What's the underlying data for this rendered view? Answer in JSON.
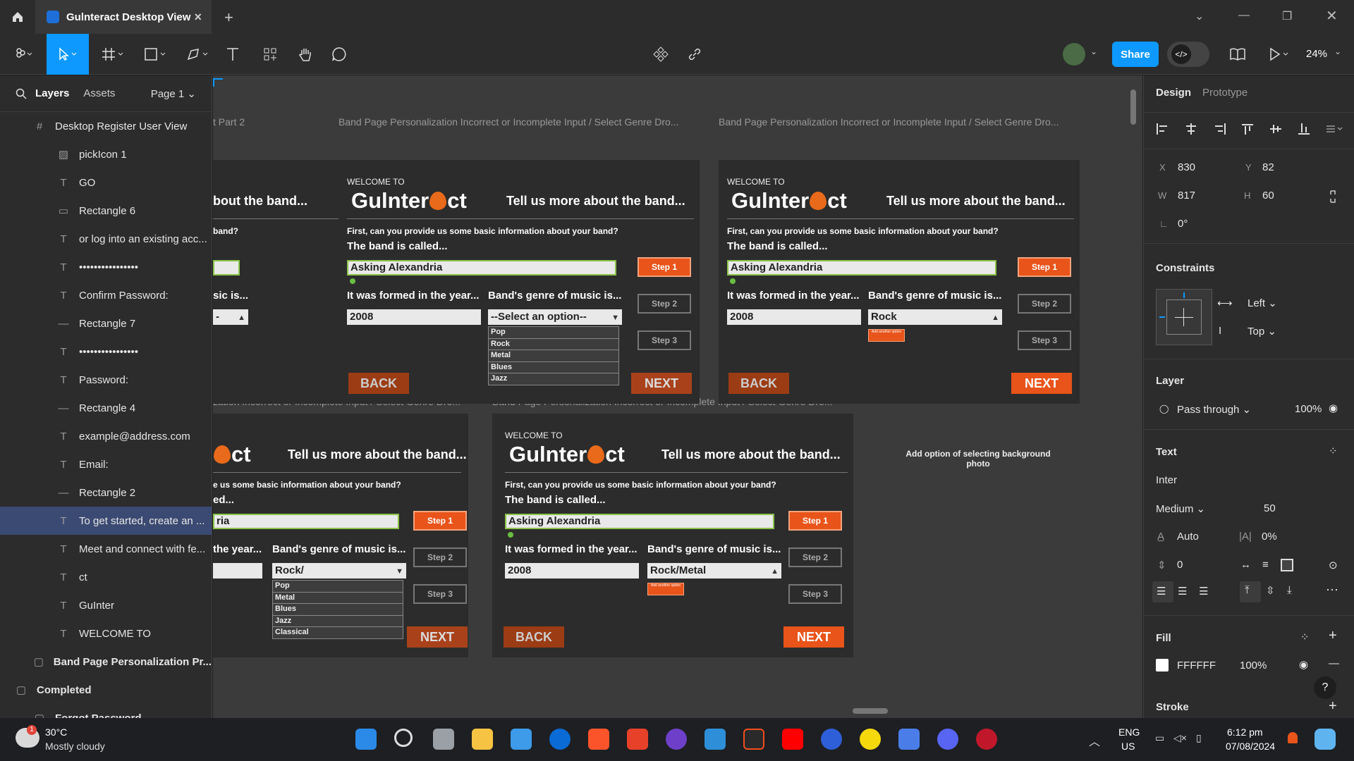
{
  "app": {
    "tab_title": "Gulnteract Desktop View",
    "zoom": "24%",
    "share_label": "Share",
    "dev_label": "</>"
  },
  "left": {
    "tab_layers": "Layers",
    "tab_assets": "Assets",
    "page": "Page 1",
    "layers": [
      "Desktop Register User View",
      "pickIcon 1",
      "GO",
      "Rectangle 6",
      "or log into an existing acc...",
      "••••••••••••••••",
      "Confirm Password:",
      "Rectangle 7",
      "••••••••••••••••",
      "Password:",
      "Rectangle 4",
      "example@address.com",
      "Email:",
      "Rectangle 2",
      "To get started, create an ...",
      "Meet and connect with fe...",
      "ct",
      "GuInter",
      "WELCOME TO",
      "Band Page Personalization Pr...",
      "Completed",
      "Forgot Password"
    ]
  },
  "canvas": {
    "label_part2": "t Part 2",
    "label_frame": "Band Page Personalization Incorrect or Incomplete Input / Select Genre Dro...",
    "label_frame_cut": "zation Incorrect or Incomplete Input / Select Genre Dro...",
    "welcome": "WELCOME TO",
    "logo_a": "Gulnter",
    "logo_b": "ct",
    "logo_cut": "ct",
    "tell": "Tell us more about the band...",
    "tell_cut": "bout the band...",
    "first_q": "First, can you provide us some basic information about your band?",
    "first_q_cut": "e us some basic information about your band?",
    "band_q": "band?",
    "called": "The band is called...",
    "called_cut": "ed...",
    "band_name": "Asking Alexandria",
    "band_name_cut": "ria",
    "formed": "It was formed in the year...",
    "formed_cut": "the year...",
    "genre": "Band's genre of music is...",
    "genre_cut": "sic is...",
    "year": "2008",
    "select_default": "--Select an option--",
    "sel_rock": "Rock",
    "sel_rock_slash": "Rock/",
    "sel_rock_metal": "Rock/Metal",
    "opts1": [
      "Pop",
      "Rock",
      "Metal",
      "Blues",
      "Jazz"
    ],
    "opts2": [
      "Pop",
      "Metal",
      "Blues",
      "Jazz",
      "Classical"
    ],
    "step1": "Step 1",
    "step2": "Step 2",
    "step3": "Step 3",
    "next": "NEXT",
    "back": "BACK",
    "add_another": "Add another option",
    "bg_note": "Add option of selecting background photo"
  },
  "right": {
    "tab_design": "Design",
    "tab_prototype": "Prototype",
    "x_label": "X",
    "x": "830",
    "y_label": "Y",
    "y": "82",
    "w_label": "W",
    "w": "817",
    "h_label": "H",
    "h": "60",
    "rot": "0°",
    "constraints": "Constraints",
    "c_left": "Left",
    "c_top": "Top",
    "layer": "Layer",
    "blend": "Pass through",
    "opacity": "100%",
    "text": "Text",
    "font": "Inter",
    "weight": "Medium",
    "size": "50",
    "lh": "Auto",
    "ls": "0%",
    "ps": "0",
    "fill": "Fill",
    "fill_hex": "FFFFFF",
    "fill_op": "100%",
    "stroke": "Stroke"
  },
  "taskbar": {
    "temp": "30°C",
    "weather": "Mostly cloudy",
    "lang1": "ENG",
    "lang2": "US",
    "time": "6:12 pm",
    "date": "07/08/2024"
  }
}
